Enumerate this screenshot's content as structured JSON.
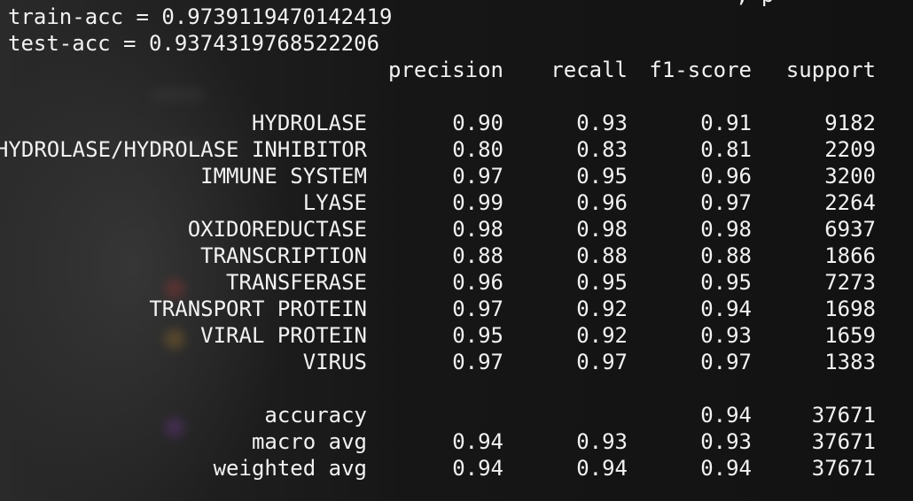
{
  "top_partial_text": ", p",
  "metrics": {
    "train_acc_line": "train-acc = 0.9739119470142419",
    "test_acc_line": "test-acc = 0.9374319768522206"
  },
  "report": {
    "headers": {
      "precision": "precision",
      "recall": "recall",
      "f1": "f1-score",
      "support": "support"
    },
    "classes": [
      {
        "label": "HYDROLASE",
        "precision": "0.90",
        "recall": "0.93",
        "f1": "0.91",
        "support": "9182"
      },
      {
        "label": "HYDROLASE/HYDROLASE INHIBITOR",
        "precision": "0.80",
        "recall": "0.83",
        "f1": "0.81",
        "support": "2209"
      },
      {
        "label": "IMMUNE SYSTEM",
        "precision": "0.97",
        "recall": "0.95",
        "f1": "0.96",
        "support": "3200"
      },
      {
        "label": "LYASE",
        "precision": "0.99",
        "recall": "0.96",
        "f1": "0.97",
        "support": "2264"
      },
      {
        "label": "OXIDOREDUCTASE",
        "precision": "0.98",
        "recall": "0.98",
        "f1": "0.98",
        "support": "6937"
      },
      {
        "label": "TRANSCRIPTION",
        "precision": "0.88",
        "recall": "0.88",
        "f1": "0.88",
        "support": "1866"
      },
      {
        "label": "TRANSFERASE",
        "precision": "0.96",
        "recall": "0.95",
        "f1": "0.95",
        "support": "7273"
      },
      {
        "label": "TRANSPORT PROTEIN",
        "precision": "0.97",
        "recall": "0.92",
        "f1": "0.94",
        "support": "1698"
      },
      {
        "label": "VIRAL PROTEIN",
        "precision": "0.95",
        "recall": "0.92",
        "f1": "0.93",
        "support": "1659"
      },
      {
        "label": "VIRUS",
        "precision": "0.97",
        "recall": "0.97",
        "f1": "0.97",
        "support": "1383"
      }
    ],
    "summary": [
      {
        "label": "accuracy",
        "precision": "",
        "recall": "",
        "f1": "0.94",
        "support": "37671"
      },
      {
        "label": "macro avg",
        "precision": "0.94",
        "recall": "0.93",
        "f1": "0.93",
        "support": "37671"
      },
      {
        "label": "weighted avg",
        "precision": "0.94",
        "recall": "0.94",
        "f1": "0.94",
        "support": "37671"
      }
    ]
  },
  "colors": {
    "text": "#f2f2f2",
    "background": "#161616"
  }
}
